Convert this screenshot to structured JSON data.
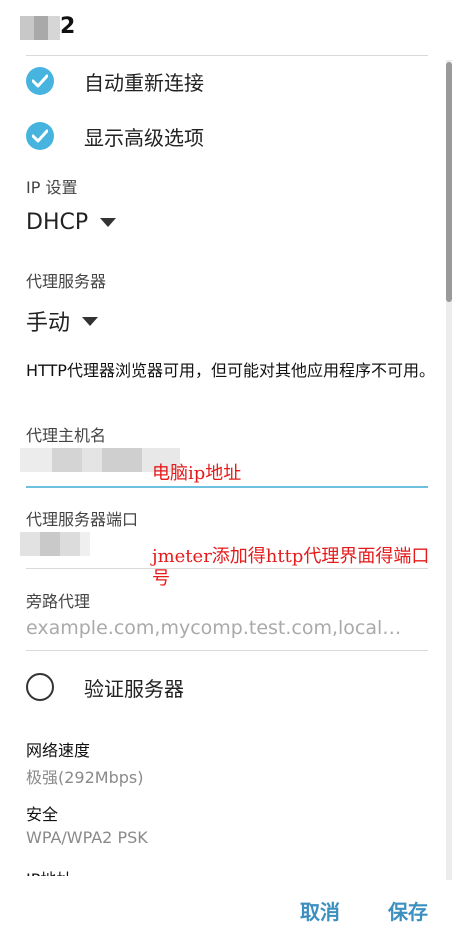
{
  "header": {
    "title_visible_suffix": "2"
  },
  "options": {
    "auto_reconnect": {
      "label": "自动重新连接",
      "checked": true
    },
    "show_advanced": {
      "label": "显示高级选项",
      "checked": true
    }
  },
  "ip_settings": {
    "label": "IP 设置",
    "value": "DHCP"
  },
  "proxy": {
    "label": "代理服务器",
    "value": "手动",
    "note": "HTTP代理器浏览器可用，但可能对其他应用程序不可用。",
    "host_label": "代理主机名",
    "port_label": "代理服务器端口",
    "bypass_label": "旁路代理",
    "bypass_placeholder": "example.com,mycomp.test.com,local…"
  },
  "annotations": {
    "host_note": "电脑ip地址",
    "port_note": "jmeter添加得http代理界面得端口号"
  },
  "verify_server": {
    "label": "验证服务器",
    "checked": false
  },
  "info": {
    "speed_title": "网络速度",
    "speed_value": "极强(292Mbps)",
    "security_title": "安全",
    "security_value": "WPA/WPA2 PSK",
    "ip_title_partial": "IP地址"
  },
  "actions": {
    "cancel": "取消",
    "save": "保存"
  },
  "colors": {
    "accent": "#46b4de",
    "button": "#3c8fbf",
    "annotation": "#e51a1a"
  }
}
